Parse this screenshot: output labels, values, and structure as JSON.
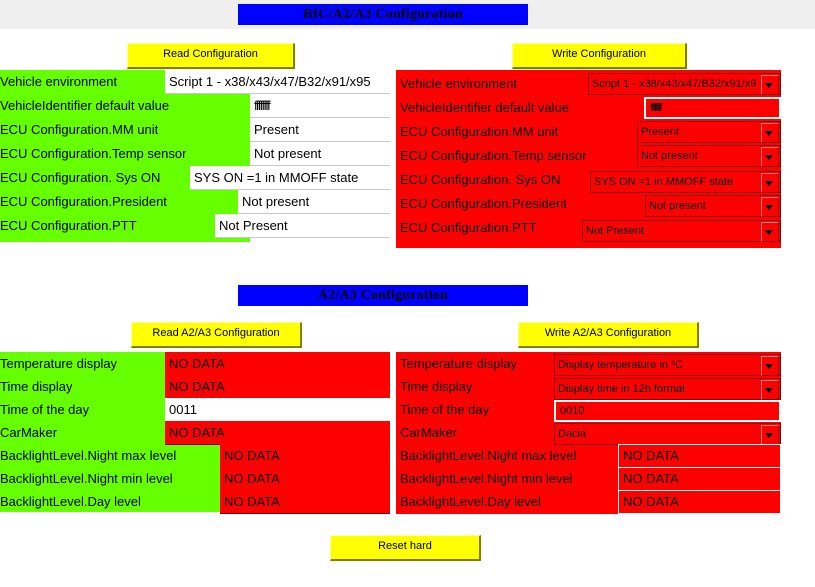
{
  "bic": {
    "title": "BIC/A2/A3 Configuration",
    "read_button": "Read Configuration",
    "write_button": "Write Configuration",
    "rows": [
      {
        "label": "Vehicle environment",
        "read": "Script 1 - x38/x43/x47/B32/x91/x95",
        "write": "Script 1 - x38/x43/x47/B32/x91/x9",
        "write_kind": "combo"
      },
      {
        "label": "VehicleIdentifier default value",
        "read": "ffffffff",
        "write": "ffffffff",
        "write_kind": "entry"
      },
      {
        "label": "ECU Configuration.MM unit",
        "read": "Present",
        "write": "Present",
        "write_kind": "combo"
      },
      {
        "label": "ECU Configuration.Temp sensor",
        "read": "Not present",
        "write": "Not present",
        "write_kind": "combo"
      },
      {
        "label": "ECU Configuration. Sys ON",
        "read": "SYS ON =1 in MMOFF state",
        "write": "SYS ON =1 in MMOFF state",
        "write_kind": "combo"
      },
      {
        "label": "ECU Configuration.President",
        "read": "Not present",
        "write": "Not present",
        "write_kind": "combo"
      },
      {
        "label": "ECU Configuration.PTT",
        "read": "Not Present",
        "write": "Not Present",
        "write_kind": "combo"
      }
    ]
  },
  "a2a3": {
    "title": "A2/A3 Configuration",
    "read_button": "Read A2/A3 Configuration",
    "write_button": "Write A2/A3 Configuration",
    "rows": [
      {
        "label": "Temperature display",
        "read": "NO DATA",
        "read_kind": "nodata",
        "write": "Display temperature in ºC",
        "write_kind": "combo"
      },
      {
        "label": "Time display",
        "read": "NO DATA",
        "read_kind": "nodata",
        "write": "Display time in 12h format",
        "write_kind": "combo"
      },
      {
        "label": "Time of the day",
        "read": "0011",
        "read_kind": "white",
        "write": "0010",
        "write_kind": "entry"
      },
      {
        "label": "CarMaker",
        "read": "NO DATA",
        "read_kind": "nodata",
        "write": "Dacia",
        "write_kind": "combo"
      },
      {
        "label": "BacklightLevel.Night max level",
        "read": "NO DATA",
        "read_kind": "nodata",
        "write": "NO DATA",
        "write_kind": "nodata"
      },
      {
        "label": "BacklightLevel.Night min level",
        "read": "NO DATA",
        "read_kind": "nodata",
        "write": "NO DATA",
        "write_kind": "nodata"
      },
      {
        "label": "BacklightLevel.Day level",
        "read": "NO DATA",
        "read_kind": "nodata",
        "write": "NO DATA",
        "write_kind": "nodata"
      }
    ]
  },
  "reset_button": "Reset hard",
  "colors": {
    "title_bg": "#0000ff",
    "button_bg": "#ffff00",
    "read_panel_bg": "#66ff00",
    "write_panel_bg": "#ff0000",
    "nodata_bg": "#ff0000"
  }
}
